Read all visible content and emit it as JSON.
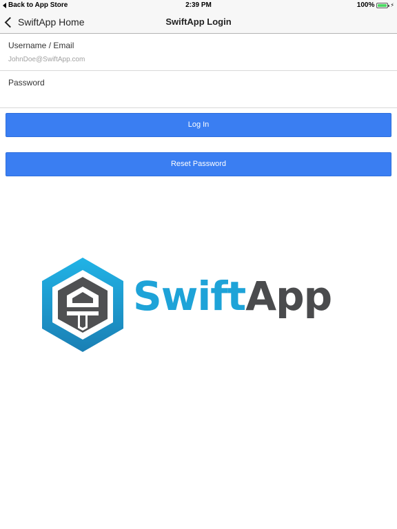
{
  "status_bar": {
    "back_label": "Back to App Store",
    "time": "2:39 PM",
    "battery_percent": "100%",
    "battery_level": 1.0,
    "battery_color": "#4cd964",
    "charging_icon": "bolt-icon"
  },
  "nav": {
    "back_label": "SwiftApp Home",
    "back_icon": "chevron-left-icon",
    "title": "SwiftApp Login"
  },
  "form": {
    "username_label": "Username / Email",
    "username_value": "",
    "username_placeholder": "JohnDoe@SwiftApp.com",
    "password_label": "Password",
    "password_value": "",
    "password_placeholder": ""
  },
  "buttons": {
    "login_label": "Log In",
    "reset_label": "Reset Password",
    "color": "#3a7ef2"
  },
  "logo": {
    "word_swift": "Swift",
    "word_app": "App",
    "swift_color": "#1ea3d8",
    "app_color": "#4a4b4d"
  }
}
